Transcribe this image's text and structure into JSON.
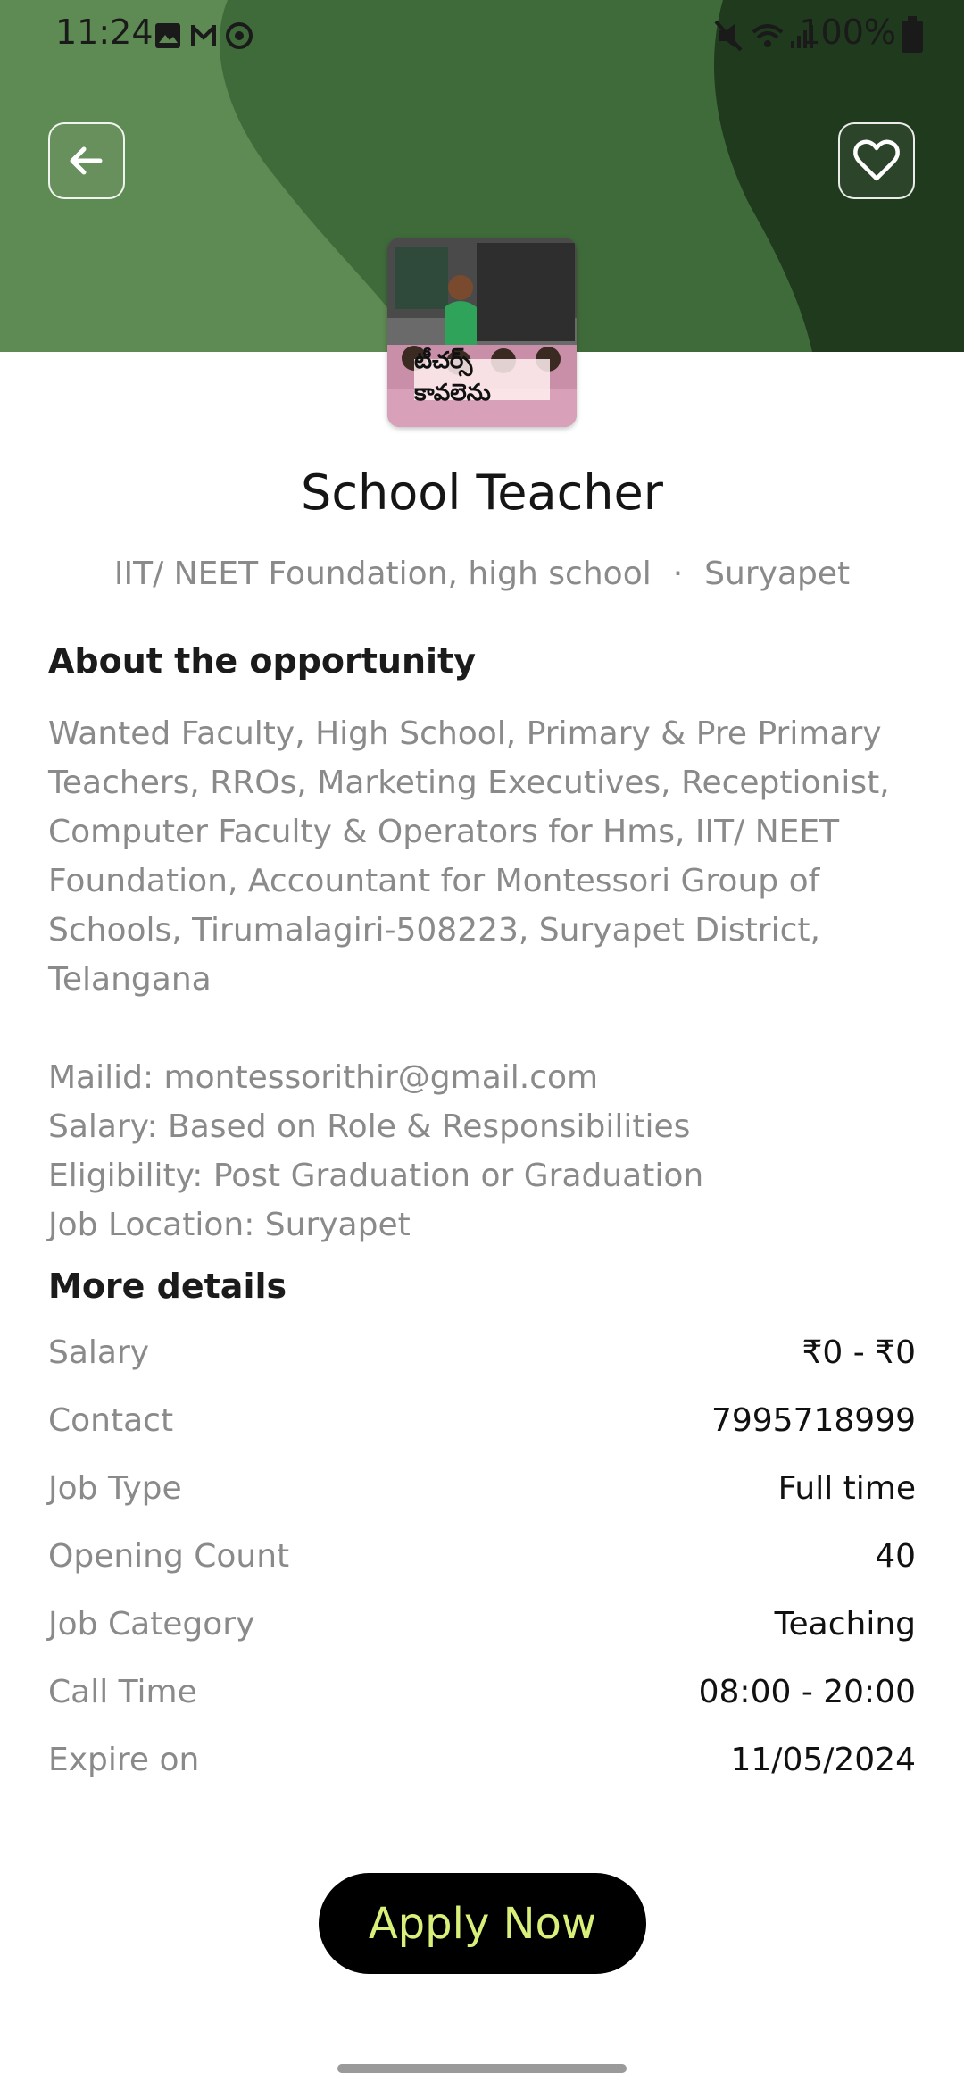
{
  "status_bar": {
    "time": "11:24",
    "battery": "100%",
    "icons": [
      "image-icon",
      "gmail-icon",
      "sync-icon",
      "mute-icon",
      "wifi-icon",
      "signal-icon",
      "battery-icon"
    ]
  },
  "header": {
    "colors": {
      "light": "#5e8a53",
      "mid": "#3f6b3a",
      "dark": "#1f3a1d"
    }
  },
  "logo": {
    "caption": "టీచర్స్ కావలెను"
  },
  "job": {
    "title": "School Teacher",
    "company": "IIT/ NEET Foundation, high school",
    "separator": "·",
    "location": "Suryapet"
  },
  "about": {
    "heading": "About the opportunity",
    "paragraph": "Wanted Faculty, High School, Primary & Pre Primary Teachers, RROs, Marketing Executives, Receptionist, Computer Faculty & Operators for Hms, IIT/ NEET Foundation, Accountant for Montessori Group of Schools, Tirumalagiri-508223, Suryapet District, Telangana",
    "mail": "Mailid: montessorithir@gmail.com",
    "salary": "Salary: Based on Role & Responsibilities",
    "eligibility": "Eligibility: Post Graduation or Graduation",
    "job_location": "Job Location: Suryapet"
  },
  "more_details": {
    "heading": "More details",
    "rows": [
      {
        "label": "Salary",
        "value": "₹0 - ₹0"
      },
      {
        "label": "Contact",
        "value": "7995718999"
      },
      {
        "label": "Job Type",
        "value": "Full time"
      },
      {
        "label": "Opening Count",
        "value": "40"
      },
      {
        "label": "Job Category",
        "value": "Teaching"
      },
      {
        "label": "Call Time",
        "value": "08:00 - 20:00"
      },
      {
        "label": "Expire on",
        "value": "11/05/2024"
      }
    ]
  },
  "apply_button": {
    "label": "Apply Now",
    "color": "#d8f07a"
  }
}
